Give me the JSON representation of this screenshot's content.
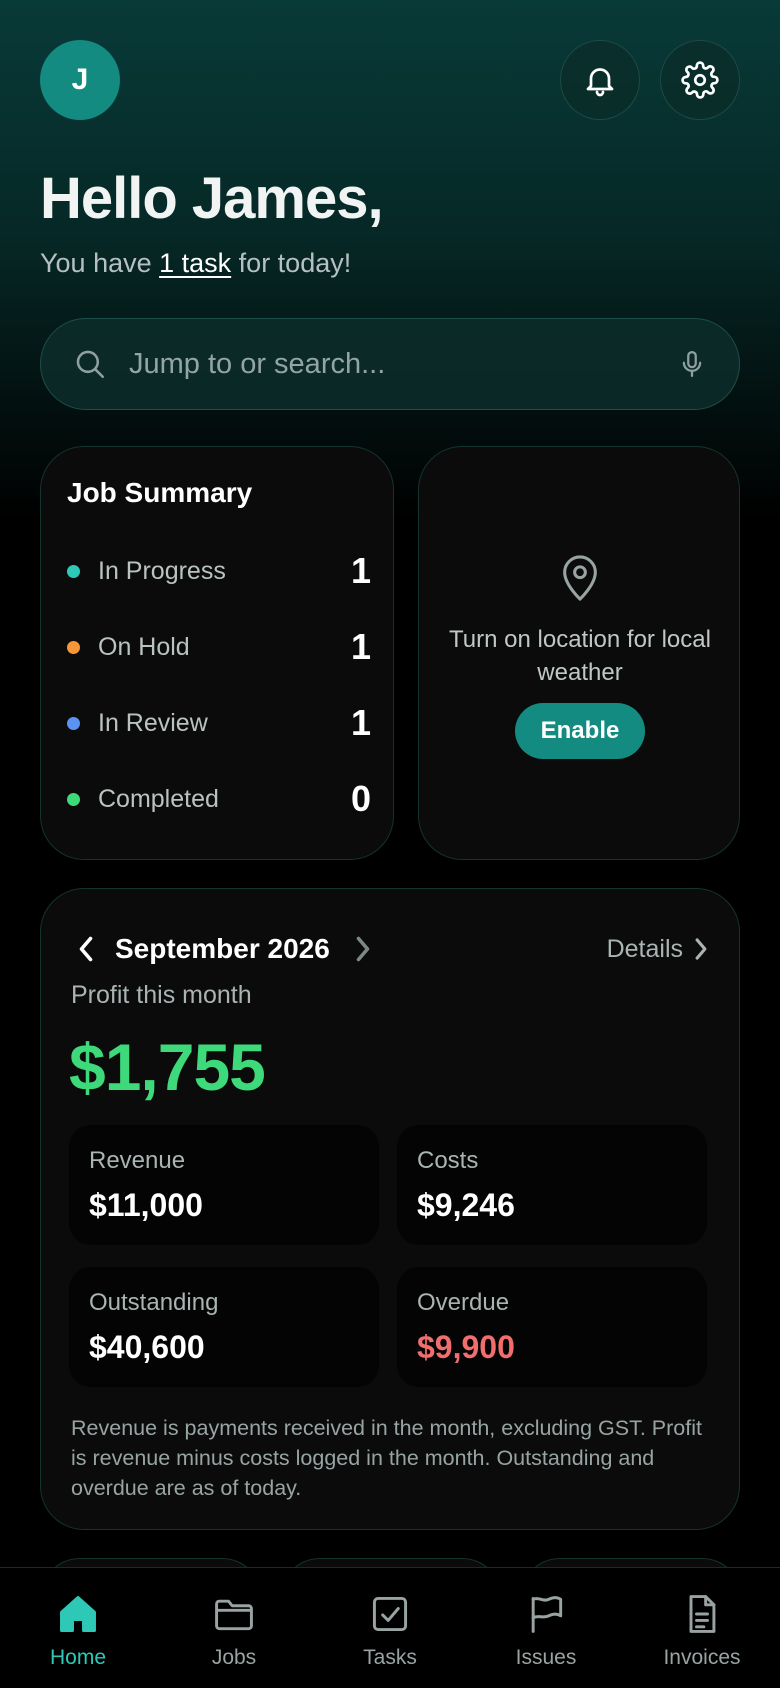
{
  "header": {
    "avatar_initial": "J",
    "greeting": "Hello James,",
    "subtitle_pre": "You have ",
    "subtitle_link": "1 task",
    "subtitle_post": " for today!"
  },
  "search": {
    "placeholder": "Jump to or search..."
  },
  "job_summary": {
    "title": "Job Summary",
    "rows": [
      {
        "label": "In Progress",
        "count": "1",
        "color": "#2ec9b6"
      },
      {
        "label": "On Hold",
        "count": "1",
        "color": "#f5963a"
      },
      {
        "label": "In Review",
        "count": "1",
        "color": "#5b93f0"
      },
      {
        "label": "Completed",
        "count": "0",
        "color": "#3ed97a"
      }
    ]
  },
  "weather": {
    "message": "Turn on location for local weather",
    "button": "Enable"
  },
  "profit": {
    "month": "September 2026",
    "details": "Details",
    "label": "Profit this month",
    "value": "$1,755",
    "stats": [
      {
        "label": "Revenue",
        "value": "$11,000"
      },
      {
        "label": "Costs",
        "value": "$9,246"
      },
      {
        "label": "Outstanding",
        "value": "$40,600"
      },
      {
        "label": "Overdue",
        "value": "$9,900"
      }
    ],
    "footnote": "Revenue is payments received in the month, excluding GST. Profit is revenue minus costs logged in the month. Outstanding and overdue are as of today."
  },
  "tabs": [
    {
      "label": "Home",
      "icon": "home-icon",
      "active": true
    },
    {
      "label": "Jobs",
      "icon": "folder-icon",
      "active": false
    },
    {
      "label": "Tasks",
      "icon": "checkbox-icon",
      "active": false
    },
    {
      "label": "Issues",
      "icon": "flag-icon",
      "active": false
    },
    {
      "label": "Invoices",
      "icon": "document-icon",
      "active": false
    }
  ],
  "colors": {
    "accent": "#138b80",
    "active_tab": "#2ec9b6",
    "profit_green": "#3ed97a",
    "overdue_red": "#f26d6d"
  }
}
